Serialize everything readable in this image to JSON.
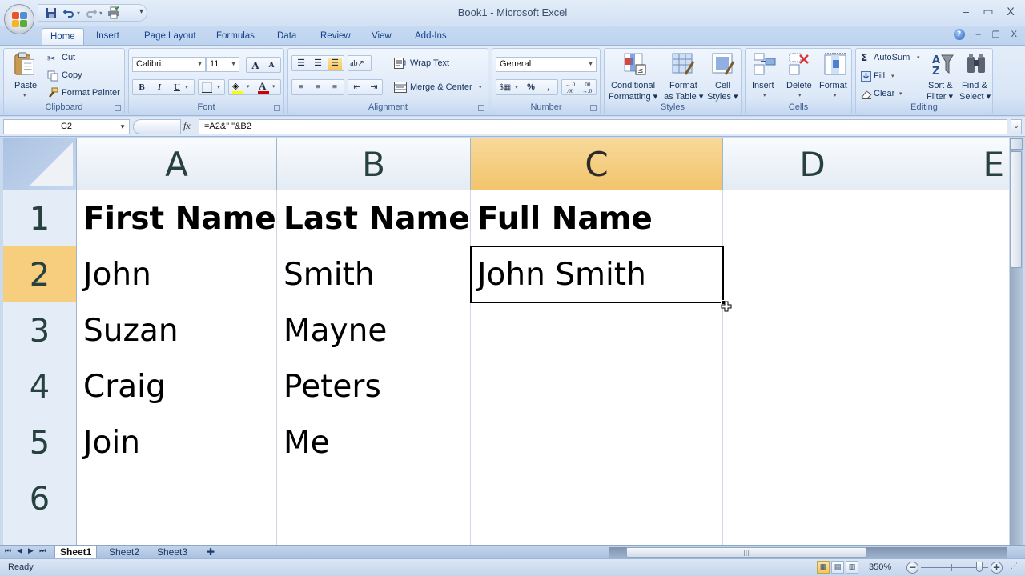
{
  "window": {
    "title": "Book1 - Microsoft Excel",
    "minimize": "–",
    "maximize": "▭",
    "close": "X"
  },
  "qat": {
    "save": "save-icon",
    "undo": "undo-icon",
    "redo": "redo-icon",
    "print": "quick-print-icon",
    "customize": "▾"
  },
  "ribbon_tabs": [
    {
      "label": "Home",
      "active": true
    },
    {
      "label": "Insert"
    },
    {
      "label": "Page Layout"
    },
    {
      "label": "Formulas"
    },
    {
      "label": "Data"
    },
    {
      "label": "Review"
    },
    {
      "label": "View"
    },
    {
      "label": "Add-Ins"
    }
  ],
  "doc_controls": {
    "help": "?",
    "minimize": "–",
    "restore": "❐",
    "close": "X"
  },
  "ribbon": {
    "clipboard": {
      "label": "Clipboard",
      "paste": "Paste",
      "cut": "Cut",
      "copy": "Copy",
      "format_painter": "Format Painter"
    },
    "font": {
      "label": "Font",
      "font_name": "Calibri",
      "font_size": "11",
      "bold": "B",
      "italic": "I",
      "underline": "U",
      "grow": "A",
      "shrink": "A",
      "fill_color": "#ffff00",
      "font_color": "#d00000"
    },
    "alignment": {
      "label": "Alignment",
      "wrap_text": "Wrap Text",
      "merge_center": "Merge & Center"
    },
    "number": {
      "label": "Number",
      "format": "General",
      "percent": "%",
      "comma": ",",
      "inc_decimal": "←.0 .00",
      "dec_decimal": ".00 →.0"
    },
    "styles": {
      "label": "Styles",
      "conditional": [
        "Conditional",
        "Formatting ▾"
      ],
      "format_table": [
        "Format",
        "as Table ▾"
      ],
      "cell_styles": [
        "Cell",
        "Styles ▾"
      ]
    },
    "cells": {
      "label": "Cells",
      "insert": "Insert",
      "delete": "Delete",
      "format": "Format"
    },
    "editing": {
      "label": "Editing",
      "autosum": "AutoSum",
      "fill": "Fill",
      "clear": "Clear",
      "sort_filter": [
        "Sort &",
        "Filter ▾"
      ],
      "find_select": [
        "Find &",
        "Select ▾"
      ]
    }
  },
  "formula_bar": {
    "name_box": "C2",
    "fx": "fx",
    "formula": "=A2&\" \"&B2"
  },
  "sheet": {
    "columns": [
      "A",
      "B",
      "C",
      "D",
      "E"
    ],
    "selected_column": "C",
    "rows": [
      "1",
      "2",
      "3",
      "4",
      "5",
      "6"
    ],
    "selected_row": "2",
    "active_cell": "C2",
    "cells": [
      [
        "First Name",
        "Last Name",
        "Full Name",
        "",
        ""
      ],
      [
        "John",
        "Smith",
        "John Smith",
        "",
        ""
      ],
      [
        "Suzan",
        "Mayne",
        "",
        "",
        ""
      ],
      [
        "Craig",
        "Peters",
        "",
        "",
        ""
      ],
      [
        "Join",
        "Me",
        "",
        "",
        ""
      ],
      [
        "",
        "",
        "",
        "",
        ""
      ]
    ]
  },
  "sheet_tabs": [
    {
      "label": "Sheet1",
      "active": true
    },
    {
      "label": "Sheet2"
    },
    {
      "label": "Sheet3"
    }
  ],
  "status": {
    "text": "Ready",
    "zoom": "350%"
  },
  "colors": {
    "selection_header": "#f2c46c",
    "ribbon_blue": "#c8daf2",
    "tab_text": "#15428b"
  }
}
